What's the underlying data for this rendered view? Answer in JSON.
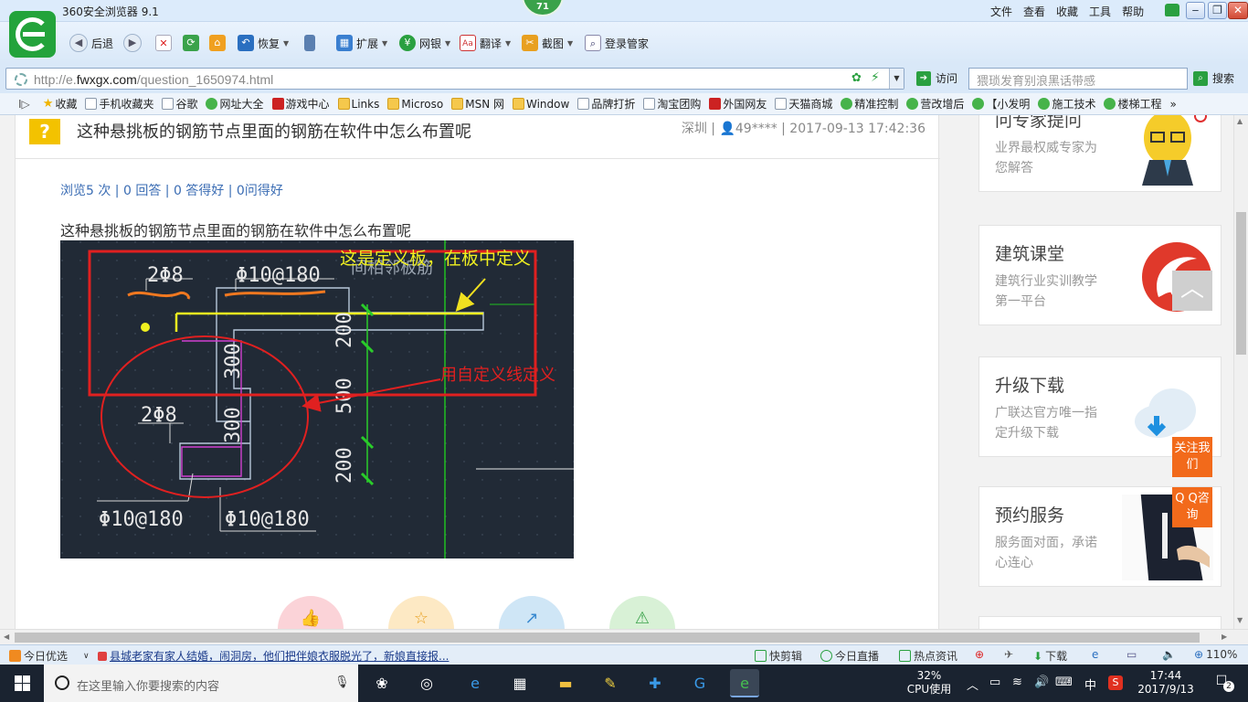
{
  "titlebar": {
    "app_title": "360安全浏览器 9.1",
    "badge": "71",
    "menus": [
      "文件",
      "查看",
      "收藏",
      "工具",
      "帮助"
    ],
    "min": "‒",
    "max": "❐",
    "close": "✕"
  },
  "toolbar": {
    "back": "后退",
    "restore": "恢复",
    "extend": "扩展",
    "bank": "网银",
    "translate": "翻译",
    "screenshot": "截图",
    "login_manager": "登录管家"
  },
  "address": {
    "url_prefix": "http://e.",
    "url_domain": "fwxgx.com",
    "url_path": "/question_1650974.html",
    "visit": "访问",
    "search_placeholder": "猥琐发育别浪黑话带感",
    "search": "搜索"
  },
  "bookmarks": [
    {
      "label": "收藏",
      "icon": "star-icon"
    },
    {
      "label": "手机收藏夹",
      "icon": "page-icon"
    },
    {
      "label": "谷歌",
      "icon": "page-icon"
    },
    {
      "label": "网址大全",
      "icon": "green-icon"
    },
    {
      "label": "游戏中心",
      "icon": "red-icon"
    },
    {
      "label": "Links",
      "icon": "folder-icon"
    },
    {
      "label": "Microso",
      "icon": "folder-icon"
    },
    {
      "label": "MSN 网",
      "icon": "folder-icon"
    },
    {
      "label": "Window",
      "icon": "folder-icon"
    },
    {
      "label": "品牌打折",
      "icon": "page-icon"
    },
    {
      "label": "淘宝团购",
      "icon": "page-icon"
    },
    {
      "label": "外国网友",
      "icon": "red-icon"
    },
    {
      "label": "天猫商城",
      "icon": "page-icon"
    },
    {
      "label": "精准控制",
      "icon": "green-icon"
    },
    {
      "label": "营改增后",
      "icon": "green-icon"
    },
    {
      "label": "【小发明",
      "icon": "green-icon"
    },
    {
      "label": "施工技术",
      "icon": "green-icon"
    },
    {
      "label": "楼梯工程",
      "icon": "green-icon"
    }
  ],
  "question": {
    "title": "这种悬挑板的钢筋节点里面的钢筋在软件中怎么布置呢",
    "meta": "深圳 | 👤49**** | 2017-09-13 17:42:36",
    "stats": "浏览5 次 | 0 回答 | 0 答得好 | 0问得好",
    "body": "这种悬挑板的钢筋节点里面的钢筋在软件中怎么布置呢"
  },
  "cad": {
    "annot_yellow": "这是定义板，在板中定义",
    "annot_red": "用自定义线定义",
    "labels": {
      "t1": "2Φ8",
      "t2": "Φ10@180",
      "t3": "2Φ8",
      "t4": "Φ10@180",
      "t5": "Φ10@180",
      "d1": "200",
      "d2": "300",
      "d3": "500",
      "d4": "300",
      "d5": "200",
      "faded": "间相邻板筋"
    }
  },
  "actions": [
    "👍",
    "☆",
    "↗",
    "⚠"
  ],
  "sidebar": [
    {
      "title": "问专家提问",
      "sub": "业界最权威专家为您解答"
    },
    {
      "title": "建筑课堂",
      "sub": "建筑行业实训教学第一平台"
    },
    {
      "title": "升级下载",
      "sub": "广联达官方唯一指定升级下载"
    },
    {
      "title": "预约服务",
      "sub": "服务面对面，承诺心连心"
    }
  ],
  "float": {
    "top": "︿",
    "follow": "关注我们",
    "qq": "Q Q咨询"
  },
  "statusbar": {
    "today": "今日优选",
    "news": "县城老家有家人结婚，闹洞房，他们把伴娘衣服脱光了，新娘直接报...",
    "kuaijian": "快剪辑",
    "live": "今日直播",
    "hot": "热点资讯",
    "download": "下载",
    "zoom": "110%"
  },
  "taskbar": {
    "search_placeholder": "在这里输入你要搜索的内容",
    "cpu_pct": "32%",
    "cpu_label": "CPU使用",
    "ime": "中",
    "time": "17:44",
    "date": "2017/9/13",
    "notif": "2"
  },
  "colors": {
    "accent_green": "#2aa040",
    "link_blue": "#3b6db4",
    "cad_bg": "#212a36",
    "orange": "#f26a1b"
  }
}
